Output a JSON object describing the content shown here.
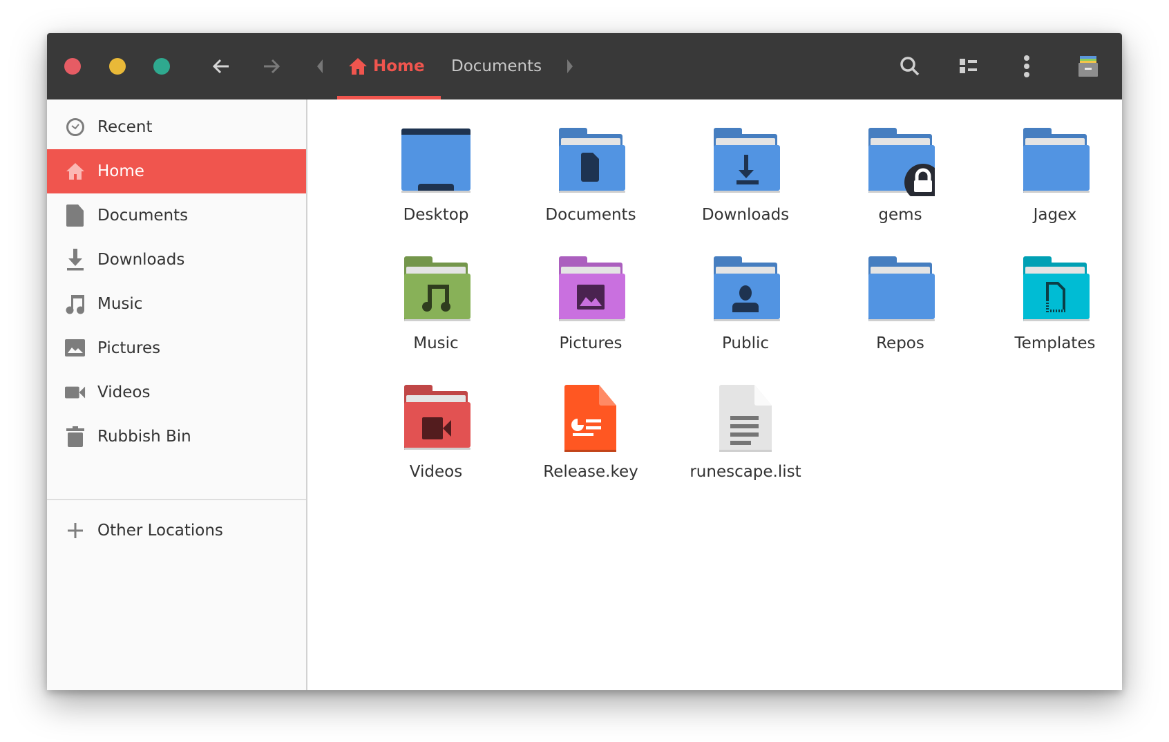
{
  "window": {
    "controls": [
      {
        "name": "close",
        "color": "#e65c64"
      },
      {
        "name": "minimize",
        "color": "#e9b938"
      },
      {
        "name": "maximize",
        "color": "#2fa98f"
      }
    ]
  },
  "header": {
    "back_icon": "arrow-left-icon",
    "forward_icon": "arrow-right-icon",
    "breadcrumb": [
      {
        "label": "Home",
        "icon": "home-icon",
        "active": true
      },
      {
        "label": "Documents",
        "active": false
      }
    ],
    "accent": "#f0554e",
    "actions": [
      "search-icon",
      "view-list-icon",
      "more-vertical-icon",
      "file-cabinet-icon"
    ]
  },
  "sidebar": {
    "items": [
      {
        "label": "Recent",
        "icon": "clock-icon",
        "active": false
      },
      {
        "label": "Home",
        "icon": "home-icon",
        "active": true
      },
      {
        "label": "Documents",
        "icon": "document-icon",
        "active": false
      },
      {
        "label": "Downloads",
        "icon": "download-icon",
        "active": false
      },
      {
        "label": "Music",
        "icon": "music-icon",
        "active": false
      },
      {
        "label": "Pictures",
        "icon": "picture-icon",
        "active": false
      },
      {
        "label": "Videos",
        "icon": "video-icon",
        "active": false
      },
      {
        "label": "Rubbish Bin",
        "icon": "trash-icon",
        "active": false
      }
    ],
    "other_locations": {
      "label": "Other Locations",
      "icon": "plus-icon"
    }
  },
  "files": [
    {
      "name": "Desktop",
      "type": "folder-desktop",
      "color": "#5294e2"
    },
    {
      "name": "Documents",
      "type": "folder-documents",
      "color": "#5294e2"
    },
    {
      "name": "Downloads",
      "type": "folder-downloads",
      "color": "#5294e2"
    },
    {
      "name": "gems",
      "type": "folder-locked",
      "color": "#5294e2"
    },
    {
      "name": "Jagex",
      "type": "folder",
      "color": "#5294e2"
    },
    {
      "name": "Music",
      "type": "folder-music",
      "color": "#88b158"
    },
    {
      "name": "Pictures",
      "type": "folder-pictures",
      "color": "#c970df"
    },
    {
      "name": "Public",
      "type": "folder-public",
      "color": "#5294e2"
    },
    {
      "name": "Repos",
      "type": "folder",
      "color": "#5294e2"
    },
    {
      "name": "Templates",
      "type": "folder-templates",
      "color": "#00bcd4"
    },
    {
      "name": "Videos",
      "type": "folder-videos",
      "color": "#e25252"
    },
    {
      "name": "Release.key",
      "type": "file-presentation",
      "color": "#ff5722"
    },
    {
      "name": "runescape.list",
      "type": "file-text",
      "color": "#e4e4e4"
    }
  ]
}
